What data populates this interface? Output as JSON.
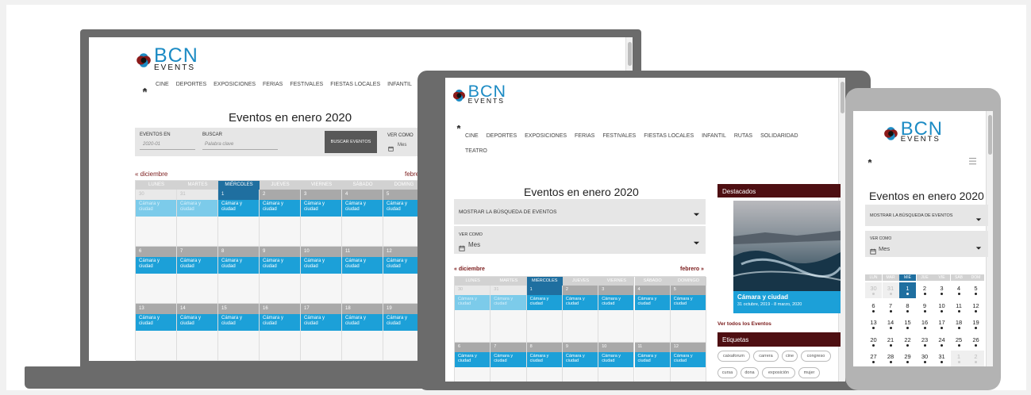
{
  "brand": {
    "name": "BCN",
    "sub": "EVENTS"
  },
  "nav_full": [
    "CINE",
    "DEPORTES",
    "EXPOSICIONES",
    "FERIAS",
    "FESTIVALES",
    "FIESTAS LOCALES",
    "INFANTIL"
  ],
  "nav_tablet": [
    "CINE",
    "DEPORTES",
    "EXPOSICIONES",
    "FERIAS",
    "FESTIVALES",
    "FIESTAS LOCALES",
    "INFANTIL",
    "RUTAS",
    "SOLIDARIDAD",
    "TEATRO"
  ],
  "page_title": "Eventos en enero 2020",
  "search": {
    "events_in_label": "EVENTOS EN",
    "events_in_value": "2020-01",
    "search_label": "BUSCAR",
    "search_placeholder": "Palabra clave",
    "button": "BUSCAR EVENTOS",
    "view_label": "VER COMO",
    "view_value": "Mes",
    "toggle": "MOSTRAR LA BÚSQUEDA DE EVENTOS"
  },
  "month_nav": {
    "prev": "« diciembre",
    "next": "febrero »",
    "next_cut": "febre"
  },
  "weekdays": [
    "LUNES",
    "MARTES",
    "MIÉRCOLES",
    "JUEVES",
    "VIERNES",
    "SÁBADO",
    "DOMINGO"
  ],
  "weekdays_cut": "DOMING",
  "weekdays_short": [
    "LUN",
    "MAR",
    "MIÉ",
    "JUE",
    "VIE",
    "SÁB",
    "DOM"
  ],
  "event_name": "Cámara y ciudad",
  "event_lines": [
    "Cámara y",
    "ciudad"
  ],
  "rows_desktop": [
    [
      "30",
      "31",
      "1",
      "2",
      "3",
      "4",
      "5"
    ],
    [
      "6",
      "7",
      "8",
      "9",
      "10",
      "11",
      "12"
    ],
    [
      "13",
      "14",
      "15",
      "16",
      "17",
      "18",
      "19"
    ]
  ],
  "rows_tablet": [
    [
      "30",
      "31",
      "1",
      "2",
      "3",
      "4",
      "5"
    ],
    [
      "6",
      "7",
      "8",
      "9",
      "10",
      "11",
      "12"
    ]
  ],
  "rows_mobile": [
    [
      "30",
      "31",
      "1",
      "2",
      "3",
      "4",
      "5"
    ],
    [
      "6",
      "7",
      "8",
      "9",
      "10",
      "11",
      "12"
    ],
    [
      "13",
      "14",
      "15",
      "16",
      "17",
      "18",
      "19"
    ],
    [
      "20",
      "21",
      "22",
      "23",
      "24",
      "25",
      "26"
    ],
    [
      "27",
      "28",
      "29",
      "30",
      "31",
      "1",
      "2"
    ]
  ],
  "sidebar": {
    "featured_title": "Destacados",
    "featured_name": "Cámara y ciudad",
    "featured_dates": "31 octubre, 2019 - 8 marzo, 2020",
    "see_all": "Ver todos los Eventos",
    "tags_title": "Etiquetas",
    "tags": [
      "caixaforum",
      "carrera",
      "cine",
      "congreso",
      "cursa",
      "dona",
      "exposición",
      "mujer"
    ]
  },
  "colors": {
    "accent": "#1ca0d8",
    "today": "#1f6fa0",
    "sidebar": "#4e0f12",
    "link": "#7a1a1a",
    "device": "#6b6b6b"
  },
  "icons": {
    "home": "home-icon",
    "calendar": "calendar-icon",
    "dropdown": "caret-down-icon",
    "menu": "hamburger-icon"
  }
}
